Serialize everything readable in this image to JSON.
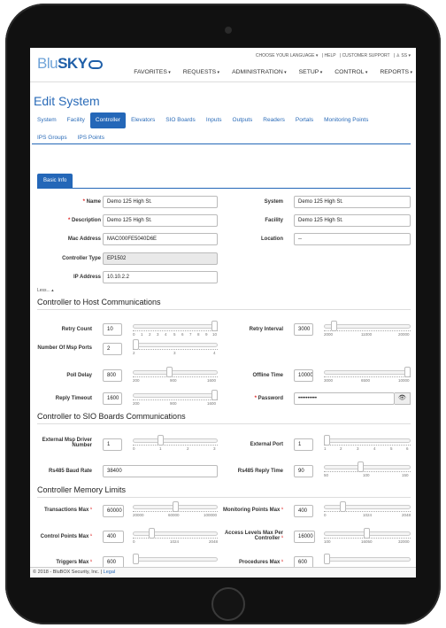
{
  "logo": {
    "blu": "Blu",
    "sky": "SKY"
  },
  "util_links": [
    "CHOOSE YOUR LANGUAGE ▾",
    "| HELP",
    "| CUSTOMER SUPPORT",
    "| ♙ SS ▾"
  ],
  "nav": [
    "FAVORITES",
    "REQUESTS",
    "ADMINISTRATION",
    "SETUP",
    "CONTROL",
    "REPORTS"
  ],
  "page_title": "Edit System",
  "tabs_row1": [
    "System",
    "Facility",
    "Controller",
    "Elevators",
    "SIO Boards",
    "Inputs",
    "Outputs",
    "Readers",
    "Portals",
    "Monitoring Points"
  ],
  "tabs_row2": [
    "IPS Groups",
    "IPS Points"
  ],
  "active_tab": "Controller",
  "subtab": "Basic Info",
  "basic": {
    "name_label": "Name",
    "name_value": "Demo 125 High St.",
    "desc_label": "Description",
    "desc_value": "Demo 125 High St.",
    "mac_label": "Mac Address",
    "mac_value": "MAC000FE5040D6E",
    "type_label": "Controller Type",
    "type_value": "EP1502",
    "ip_label": "IP Address",
    "ip_value": "10.10.2.2",
    "system_label": "System",
    "system_value": "Demo 125 High St.",
    "facility_label": "Facility",
    "facility_value": "Demo 125 High St.",
    "location_label": "Location",
    "location_value": "--",
    "less": "Less... ▴"
  },
  "host": {
    "title": "Controller to Host Communications",
    "retry_count_label": "Retry Count",
    "retry_count_value": "10",
    "retry_count_ticks": [
      "0",
      "1",
      "2",
      "3",
      "4",
      "5",
      "6",
      "7",
      "8",
      "9",
      "10"
    ],
    "retry_interval_label": "Retry Interval",
    "retry_interval_value": "3000",
    "retry_interval_ticks": [
      "2000",
      "11000",
      "20000"
    ],
    "msp_ports_label": "Number Of Msp Ports",
    "msp_ports_value": "2",
    "msp_ports_ticks": [
      "2",
      "3",
      "4"
    ],
    "poll_delay_label": "Poll Delay",
    "poll_delay_value": "800",
    "poll_delay_ticks": [
      "200",
      "900",
      "1600"
    ],
    "offline_label": "Offline Time",
    "offline_value": "10000",
    "offline_ticks": [
      "3000",
      "6500",
      "10000"
    ],
    "reply_timeout_label": "Reply Timeout",
    "reply_timeout_value": "1600",
    "reply_timeout_ticks": [
      "200",
      "900",
      "1600"
    ],
    "password_label": "Password",
    "password_value": "••••••••••"
  },
  "sio": {
    "title": "Controller to SIO Boards Communications",
    "ext_msp_label": "External Msp Driver Number",
    "ext_msp_value": "1",
    "ext_msp_ticks": [
      "0",
      "1",
      "2",
      "3"
    ],
    "ext_port_label": "External Port",
    "ext_port_value": "1",
    "ext_port_ticks": [
      "1",
      "2",
      "3",
      "4",
      "5",
      "6"
    ],
    "baud_label": "Rs485 Baud Rate",
    "baud_value": "38400",
    "reply_time_label": "Rs485 Reply Time",
    "reply_time_value": "90",
    "reply_time_ticks": [
      "50",
      "100",
      "150"
    ]
  },
  "memory": {
    "title": "Controller Memory Limits",
    "trans_label": "Transactions Max",
    "trans_value": "60000",
    "trans_ticks": [
      "20000",
      "60000",
      "100000"
    ],
    "monpts_label": "Monitoring Points Max",
    "monpts_value": "400",
    "monpts_ticks": [
      "0",
      "1024",
      "2048"
    ],
    "ctrlpts_label": "Control Points Max",
    "ctrlpts_value": "400",
    "ctrlpts_ticks": [
      "0",
      "1024",
      "2048"
    ],
    "access_label": "Access Levels Max Per Controller",
    "access_value": "16000",
    "access_ticks": [
      "100",
      "16050",
      "32000"
    ],
    "triggers_label": "Triggers Max",
    "triggers_value": "600",
    "procedures_label": "Procedures Max",
    "procedures_value": "600"
  },
  "footer": {
    "text": "© 2018 - BluBOX Security, Inc. |",
    "link": "Legal"
  },
  "colors": {
    "accent": "#2467b8",
    "required": "#dd2222"
  }
}
